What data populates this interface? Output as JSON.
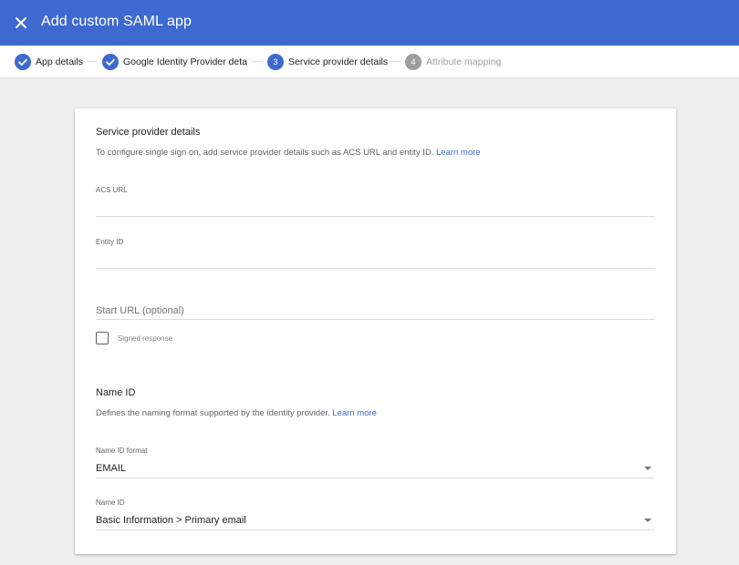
{
  "header": {
    "title": "Add custom SAML app",
    "close_icon": "close-icon",
    "background": "#3e6ad0"
  },
  "stepper": {
    "steps": [
      {
        "number": "1",
        "label": "App details",
        "state": "done"
      },
      {
        "number": "2",
        "label": "Google Identity Provider details",
        "state": "done"
      },
      {
        "number": "3",
        "label": "Service provider details",
        "state": "active"
      },
      {
        "number": "4",
        "label": "Attribute mapping",
        "state": "todo"
      }
    ]
  },
  "service_provider": {
    "title": "Service provider details",
    "description": "To configure single sign on, add service provider details such as ACS URL and entity ID.",
    "learn_more": "Learn more",
    "acs_url": {
      "label": "ACS URL",
      "value": ""
    },
    "entity_id": {
      "label": "Entity ID",
      "value": ""
    },
    "start_url": {
      "placeholder": "Start URL (optional)",
      "value": ""
    },
    "signed_response": {
      "label": "Signed response",
      "checked": false
    }
  },
  "name_id_section": {
    "title": "Name ID",
    "description": "Defines the naming format supported by the identity provider.",
    "learn_more": "Learn more",
    "format": {
      "label": "Name ID format",
      "value": "EMAIL"
    },
    "name_id": {
      "label": "Name ID",
      "value": "Basic Information > Primary email"
    }
  },
  "colors": {
    "accent": "#3e6ad0",
    "muted": "#9e9e9e",
    "background": "#eeeeee"
  }
}
